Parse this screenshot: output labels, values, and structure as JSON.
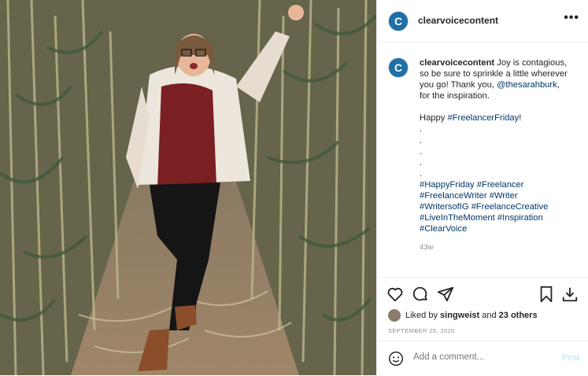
{
  "header": {
    "username": "clearvoicecontent",
    "avatar_letter": "C",
    "more_icon": "more-horizontal-icon"
  },
  "caption": {
    "username": "clearvoicecontent",
    "text_1": " Joy is contagious,",
    "text_2": "so be sure to sprinkle a little wherever",
    "text_3": "you go! Thank you, ",
    "mention": "@thesarahburk",
    "text_3b": ",",
    "text_4": "for the inspiration.",
    "happy": "Happy ",
    "happy_tag": "#FreelancerFriday",
    "happy_end": "!",
    "dots": [
      ".",
      ".",
      ".",
      ".",
      "."
    ],
    "tags_1a": "#HappyFriday",
    "tags_1b": "#Freelancer",
    "tags_2a": "#FreelanceWriter",
    "tags_2b": "#Writer",
    "tags_3a": "#WritersofIG",
    "tags_3b": "#FreelanceCreative",
    "tags_4a": "#LiveInTheMoment",
    "tags_4b": "#Inspiration",
    "tags_5": "#ClearVoice"
  },
  "age": "43w",
  "actions": {
    "icons": [
      "heart-icon",
      "comment-icon",
      "share-icon",
      "bookmark-icon",
      "download-icon"
    ]
  },
  "likes": {
    "prefix": "Liked by ",
    "user": "singweist",
    "middle": " and ",
    "others": "23 others"
  },
  "date": "SEPTEMBER 25, 2020",
  "comment_box": {
    "placeholder": "Add a comment...",
    "post_label": "Post"
  },
  "colors": {
    "brand_blue": "#1f6fa8",
    "link": "#00376b",
    "post_disabled": "#b2dffc"
  }
}
